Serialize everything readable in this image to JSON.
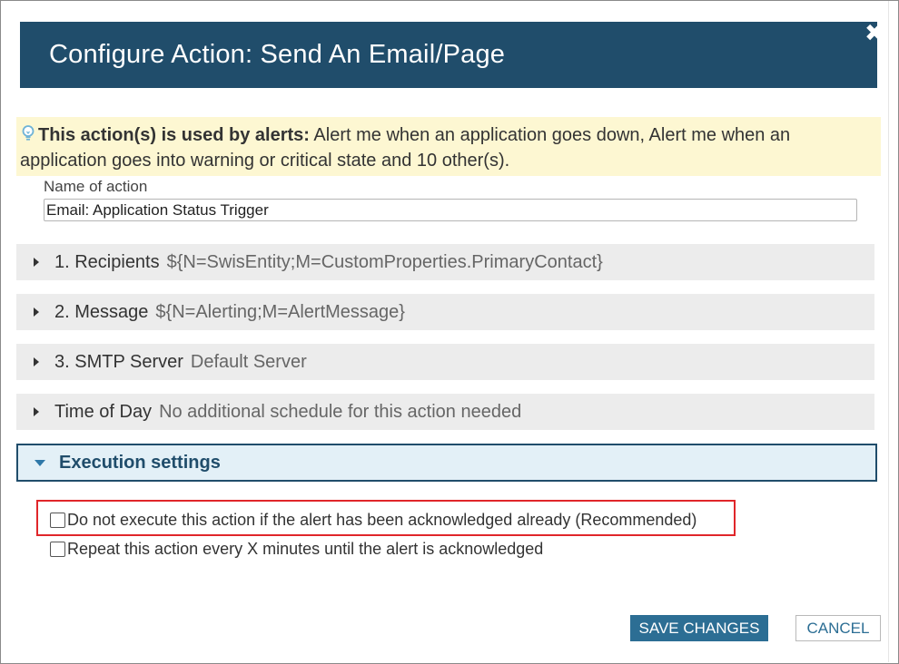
{
  "dialog": {
    "title": "Configure Action: Send An Email/Page",
    "close_icon": "close-icon"
  },
  "banner": {
    "icon": "lightbulb-icon",
    "bold_text": "This action(s) is used by alerts:",
    "text": " Alert me when an application goes down, Alert me when an application goes into warning or critical state and 10 other(s)."
  },
  "name_field": {
    "label": "Name of action",
    "value": "Email: Application Status Trigger"
  },
  "sections": [
    {
      "title": "1. Recipients",
      "detail": "${N=SwisEntity;M=CustomProperties.PrimaryContact}"
    },
    {
      "title": "2. Message",
      "detail": "${N=Alerting;M=AlertMessage}"
    },
    {
      "title": "3. SMTP Server",
      "detail": "Default Server"
    },
    {
      "title": "Time of Day",
      "detail": "No additional schedule for this action needed"
    }
  ],
  "execution": {
    "title": "Execution settings",
    "options": [
      {
        "label": "Do not execute this action if the alert has been acknowledged already (Recommended)",
        "checked": false,
        "highlighted": true
      },
      {
        "label": "Repeat this action every X minutes until the alert is acknowledged",
        "checked": false
      }
    ]
  },
  "buttons": {
    "save": "SAVE CHANGES",
    "cancel": "CANCEL"
  },
  "colors": {
    "title_bar": "#204d6b",
    "banner_bg": "#fdf7d2",
    "accent": "#2c6e94",
    "highlight": "#e0262a"
  }
}
